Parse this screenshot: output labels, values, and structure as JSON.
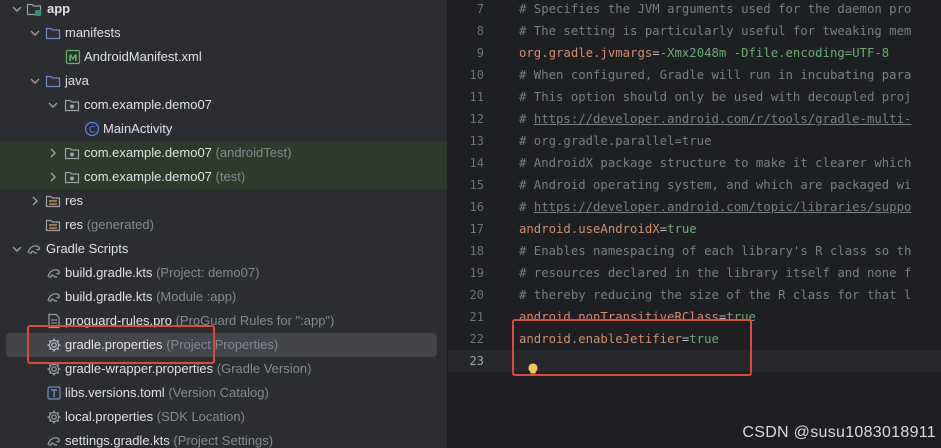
{
  "tree": {
    "items": [
      {
        "label": "app",
        "hint": ""
      },
      {
        "label": "manifests",
        "hint": ""
      },
      {
        "label": "AndroidManifest.xml",
        "hint": ""
      },
      {
        "label": "java",
        "hint": ""
      },
      {
        "label": "com.example.demo07",
        "hint": ""
      },
      {
        "label": "MainActivity",
        "hint": ""
      },
      {
        "label": "com.example.demo07",
        "hint": "(androidTest)"
      },
      {
        "label": "com.example.demo07",
        "hint": "(test)"
      },
      {
        "label": "res",
        "hint": ""
      },
      {
        "label": "res",
        "hint": "(generated)"
      },
      {
        "label": "Gradle Scripts",
        "hint": ""
      },
      {
        "label": "build.gradle.kts",
        "hint": "(Project: demo07)"
      },
      {
        "label": "build.gradle.kts",
        "hint": "(Module :app)"
      },
      {
        "label": "proguard-rules.pro",
        "hint": "(ProGuard Rules for \":app\")"
      },
      {
        "label": "gradle.properties",
        "hint": "(Project Properties)"
      },
      {
        "label": "gradle-wrapper.properties",
        "hint": "(Gradle Version)"
      },
      {
        "label": "libs.versions.toml",
        "hint": "(Version Catalog)"
      },
      {
        "label": "local.properties",
        "hint": "(SDK Location)"
      },
      {
        "label": "settings.gradle.kts",
        "hint": "(Project Settings)"
      }
    ]
  },
  "editor": {
    "current_line": "23",
    "lines": [
      {
        "num": "7",
        "text": "# Specifies the JVM arguments used for the daemon pro"
      },
      {
        "num": "8",
        "text": "# The setting is particularly useful for tweaking mem"
      },
      {
        "num": "9",
        "key": "org.gradle.jvmargs",
        "value": "-Xmx2048m -Dfile.encoding=UTF-8"
      },
      {
        "num": "10",
        "text": "# When configured, Gradle will run in incubating para"
      },
      {
        "num": "11",
        "text": "# This option should only be used with decoupled proj"
      },
      {
        "num": "12",
        "prefix": "# ",
        "link": "https://developer.android.com/r/tools/gradle-multi-"
      },
      {
        "num": "13",
        "text": "# org.gradle.parallel=true"
      },
      {
        "num": "14",
        "text": "# AndroidX package structure to make it clearer which"
      },
      {
        "num": "15",
        "text": "# Android operating system, and which are packaged wi"
      },
      {
        "num": "16",
        "prefix": "# ",
        "link": "https://developer.android.com/topic/libraries/suppo"
      },
      {
        "num": "17",
        "key": "android.useAndroidX",
        "value": "true"
      },
      {
        "num": "18",
        "text": "# Enables namespacing of each library's R class so th"
      },
      {
        "num": "19",
        "text": "# resources declared in the library itself and none f"
      },
      {
        "num": "20",
        "text": "# thereby reducing the size of the R class for that l"
      },
      {
        "num": "21",
        "key": "android.nonTransitiveRClass",
        "value": "true"
      },
      {
        "num": "22",
        "key": "android.enableJetifier",
        "value": "true"
      },
      {
        "num": "23",
        "text": ""
      }
    ]
  },
  "colors": {
    "annotation_box": "#e0473f",
    "comment": "#7a7e85",
    "key": "#cf8e6d",
    "value": "#6aab73"
  },
  "watermark": "CSDN @susu1083018911"
}
